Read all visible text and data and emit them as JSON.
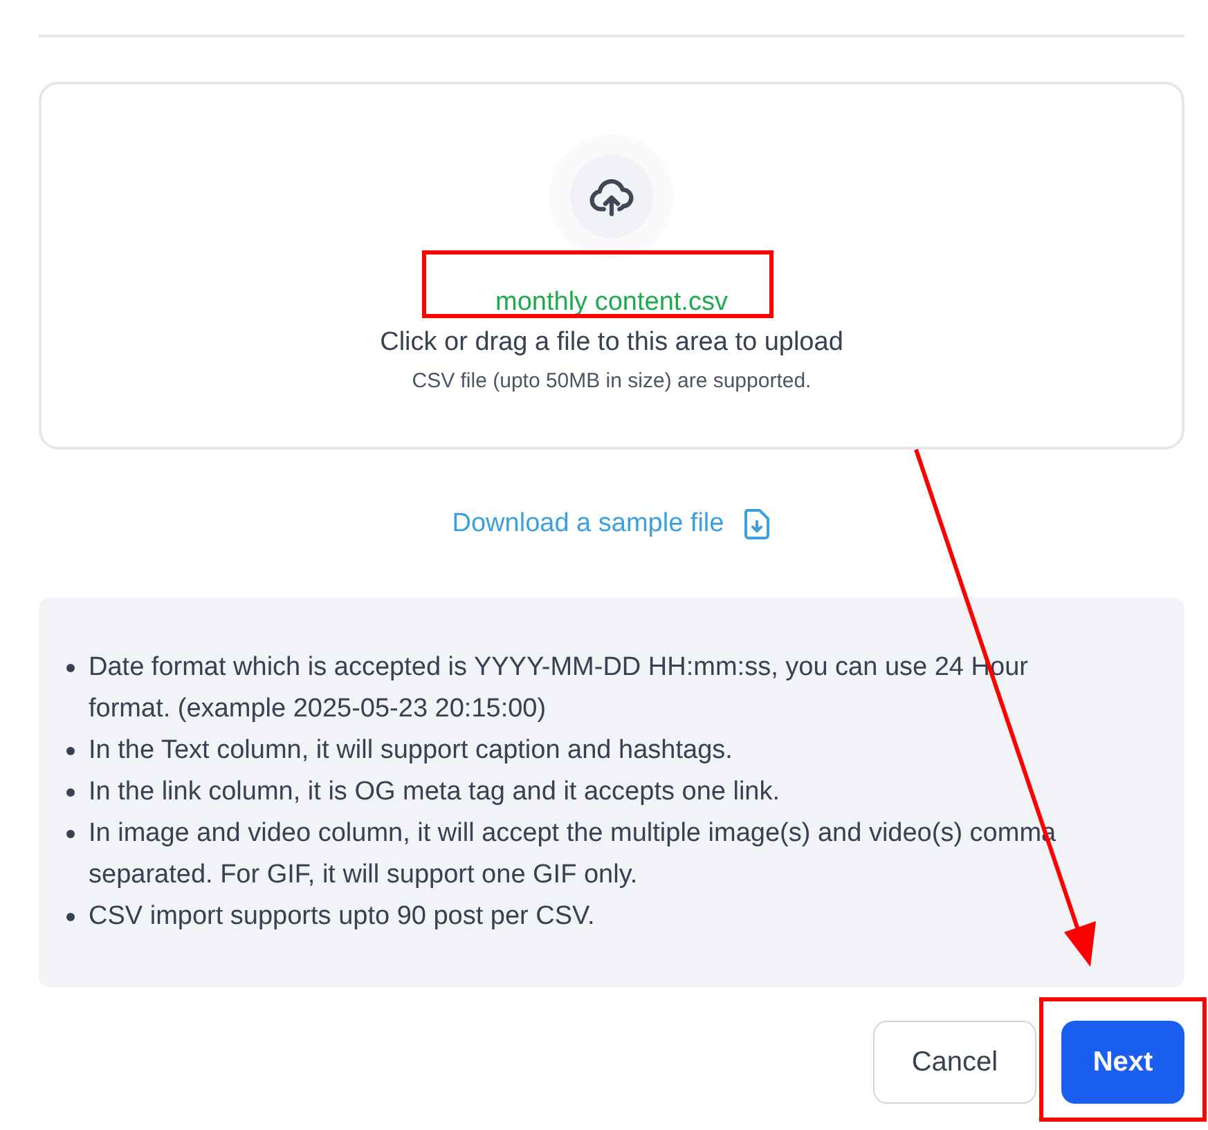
{
  "upload": {
    "file_name": "monthly content.csv",
    "prompt": "Click or drag a file to this area to upload",
    "hint": "CSV file (upto 50MB in size) are supported."
  },
  "sample_link": "Download a sample file",
  "notes": [
    "Date format which is accepted is YYYY-MM-DD HH:mm:ss, you can use 24 Hour format. (example 2025-05-23 20:15:00)",
    "In the Text column, it will support caption and hashtags.",
    "In the link column, it is OG meta tag and it accepts one link.",
    "In image and video column, it will accept the multiple image(s) and video(s) comma separated. For GIF, it will support one GIF only.",
    "CSV import supports upto 90 post per CSV."
  ],
  "buttons": [
    {
      "label": "Cancel",
      "kind": "secondary"
    },
    {
      "label": "Next",
      "kind": "primary"
    }
  ]
}
